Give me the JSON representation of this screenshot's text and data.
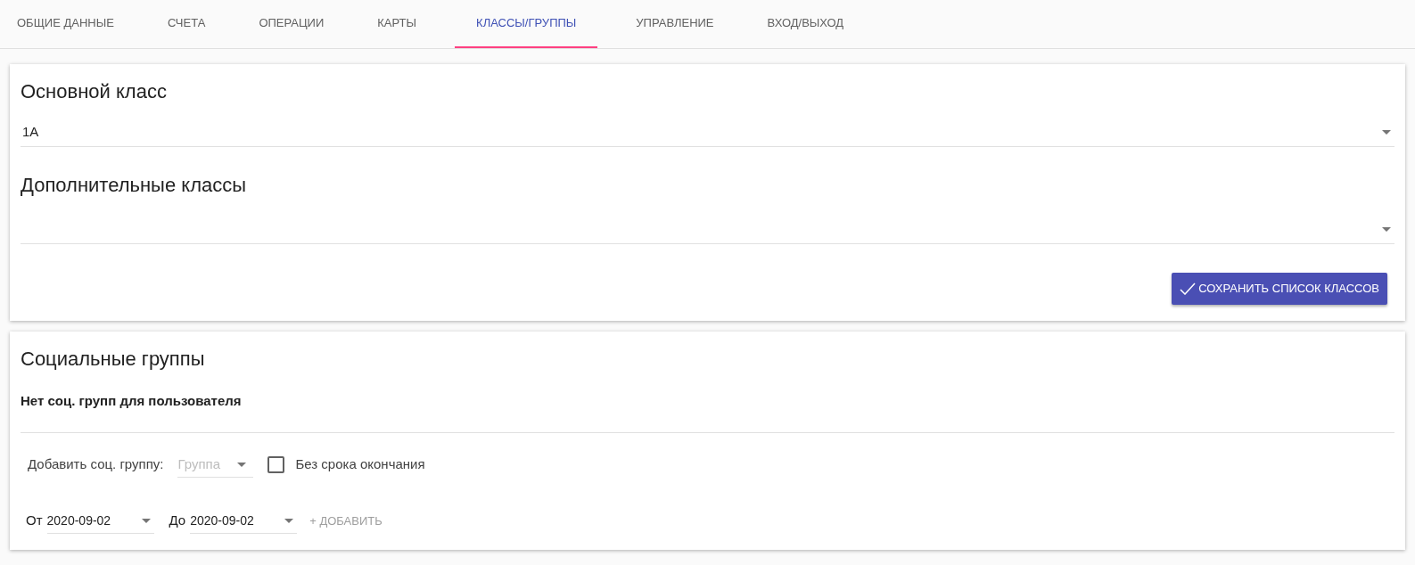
{
  "tabs": [
    {
      "label": "ОБЩИЕ ДАННЫЕ",
      "selected": false
    },
    {
      "label": "СЧЕТА",
      "selected": false
    },
    {
      "label": "ОПЕРАЦИИ",
      "selected": false
    },
    {
      "label": "КАРТЫ",
      "selected": false
    },
    {
      "label": "КЛАССЫ/ГРУППЫ",
      "selected": true
    },
    {
      "label": "УПРАВЛЕНИЕ",
      "selected": false
    },
    {
      "label": "ВХОД/ВЫХОД",
      "selected": false
    }
  ],
  "classes_card": {
    "main_title": "Основной класс",
    "main_value": "1А",
    "extra_title": "Дополнительные классы",
    "save_button": "СОХРАНИТЬ СПИСОК КЛАССОВ"
  },
  "groups_card": {
    "title": "Социальные группы",
    "empty_message": "Нет соц. групп для пользователя",
    "add_label": "Добавить соц. группу:",
    "group_placeholder": "Группа",
    "no_end": {
      "label": "Без срока окончания",
      "checked": false
    },
    "from_label": "От",
    "from_value": "2020-09-02",
    "to_label": "До",
    "to_value": "2020-09-02",
    "add_button": "+ ДОБАВИТЬ"
  }
}
